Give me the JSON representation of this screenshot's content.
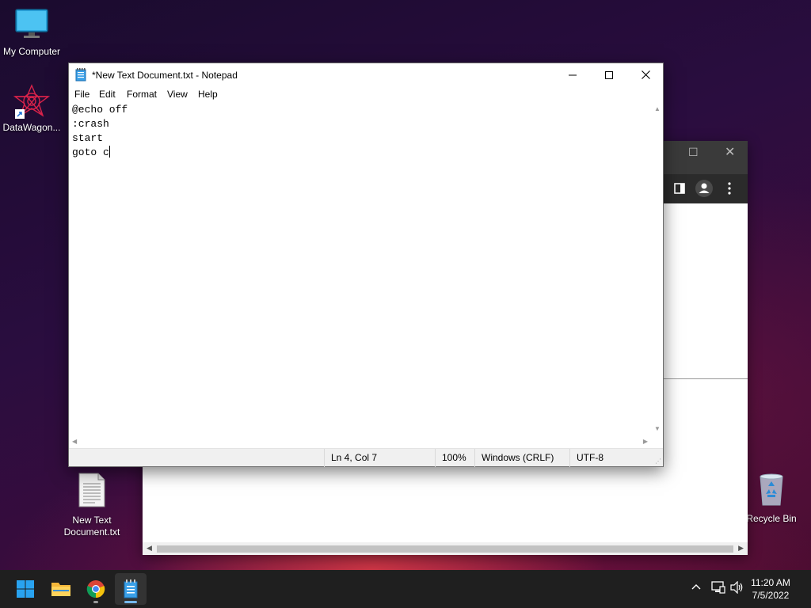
{
  "desktop": {
    "icons": [
      {
        "label": "My Computer"
      },
      {
        "label": "DataWagon..."
      },
      {
        "label": "New Text Document.txt"
      },
      {
        "label": "Recycle Bin"
      }
    ]
  },
  "notepad": {
    "title": "*New Text Document.txt - Notepad",
    "menu": [
      "File",
      "Edit",
      "Format",
      "View",
      "Help"
    ],
    "content_lines": [
      "@echo off",
      ":crash",
      "start",
      "goto c"
    ],
    "status": {
      "position": "Ln 4, Col 7",
      "zoom": "100%",
      "line_ending": "Windows (CRLF)",
      "encoding": "UTF-8"
    }
  },
  "taskbar": {
    "apps": [
      "start-icon",
      "file-explorer-icon",
      "chrome-icon",
      "notepad-icon"
    ],
    "time": "11:20 AM",
    "date": "7/5/2022"
  }
}
